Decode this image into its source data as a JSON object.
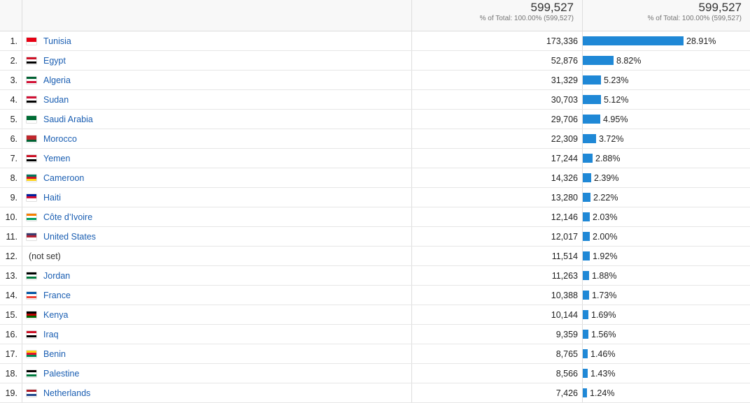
{
  "header": {
    "col3_total": "599,527",
    "col3_pct": "% of Total: 100.00% (599,527)",
    "col4_total": "599,527",
    "col4_pct": "% of Total: 100.00% (599,527)"
  },
  "rows": [
    {
      "rank": "1.",
      "country": "Tunisia",
      "value": "173,336",
      "pct": "28.91%",
      "share": 28.91,
      "flag": [
        "#e70013",
        "#e70013",
        "#ffffff"
      ]
    },
    {
      "rank": "2.",
      "country": "Egypt",
      "value": "52,876",
      "pct": "8.82%",
      "share": 8.82,
      "flag": [
        "#ce1126",
        "#ffffff",
        "#000000"
      ]
    },
    {
      "rank": "3.",
      "country": "Algeria",
      "value": "31,329",
      "pct": "5.23%",
      "share": 5.23,
      "flag": [
        "#006233",
        "#ffffff",
        "#d21034"
      ]
    },
    {
      "rank": "4.",
      "country": "Sudan",
      "value": "30,703",
      "pct": "5.12%",
      "share": 5.12,
      "flag": [
        "#d21034",
        "#ffffff",
        "#000000"
      ]
    },
    {
      "rank": "5.",
      "country": "Saudi Arabia",
      "value": "29,706",
      "pct": "4.95%",
      "share": 4.95,
      "flag": [
        "#006c35",
        "#006c35",
        "#ffffff"
      ]
    },
    {
      "rank": "6.",
      "country": "Morocco",
      "value": "22,309",
      "pct": "3.72%",
      "share": 3.72,
      "flag": [
        "#c1272d",
        "#c1272d",
        "#006233"
      ]
    },
    {
      "rank": "7.",
      "country": "Yemen",
      "value": "17,244",
      "pct": "2.88%",
      "share": 2.88,
      "flag": [
        "#ce1126",
        "#ffffff",
        "#000000"
      ]
    },
    {
      "rank": "8.",
      "country": "Cameroon",
      "value": "14,326",
      "pct": "2.39%",
      "share": 2.39,
      "flag": [
        "#007a5e",
        "#ce1126",
        "#fcd116"
      ]
    },
    {
      "rank": "9.",
      "country": "Haiti",
      "value": "13,280",
      "pct": "2.22%",
      "share": 2.22,
      "flag": [
        "#00209f",
        "#d21034",
        "#ffffff"
      ]
    },
    {
      "rank": "10.",
      "country": "Côte d’Ivoire",
      "value": "12,146",
      "pct": "2.03%",
      "share": 2.03,
      "flag": [
        "#f77f00",
        "#ffffff",
        "#009e60"
      ]
    },
    {
      "rank": "11.",
      "country": "United States",
      "value": "12,017",
      "pct": "2.00%",
      "share": 2.0,
      "flag": [
        "#3c3b6e",
        "#b22234",
        "#ffffff"
      ]
    },
    {
      "rank": "12.",
      "country": "(not set)",
      "value": "11,514",
      "pct": "1.92%",
      "share": 1.92,
      "flag": null
    },
    {
      "rank": "13.",
      "country": "Jordan",
      "value": "11,263",
      "pct": "1.88%",
      "share": 1.88,
      "flag": [
        "#000000",
        "#ffffff",
        "#007a3d"
      ]
    },
    {
      "rank": "14.",
      "country": "France",
      "value": "10,388",
      "pct": "1.73%",
      "share": 1.73,
      "flag": [
        "#0055a4",
        "#ffffff",
        "#ef4135"
      ]
    },
    {
      "rank": "15.",
      "country": "Kenya",
      "value": "10,144",
      "pct": "1.69%",
      "share": 1.69,
      "flag": [
        "#000000",
        "#bb0000",
        "#006600"
      ]
    },
    {
      "rank": "16.",
      "country": "Iraq",
      "value": "9,359",
      "pct": "1.56%",
      "share": 1.56,
      "flag": [
        "#ce1126",
        "#ffffff",
        "#000000"
      ]
    },
    {
      "rank": "17.",
      "country": "Benin",
      "value": "8,765",
      "pct": "1.46%",
      "share": 1.46,
      "flag": [
        "#fcd116",
        "#e8112d",
        "#008751"
      ]
    },
    {
      "rank": "18.",
      "country": "Palestine",
      "value": "8,566",
      "pct": "1.43%",
      "share": 1.43,
      "flag": [
        "#000000",
        "#ffffff",
        "#007a3d"
      ]
    },
    {
      "rank": "19.",
      "country": "Netherlands",
      "value": "7,426",
      "pct": "1.24%",
      "share": 1.24,
      "flag": [
        "#ae1c28",
        "#ffffff",
        "#21468b"
      ]
    }
  ],
  "colors": {
    "bar": "#1f88d6",
    "link": "#1a5eb2",
    "border": "#dddddd"
  }
}
